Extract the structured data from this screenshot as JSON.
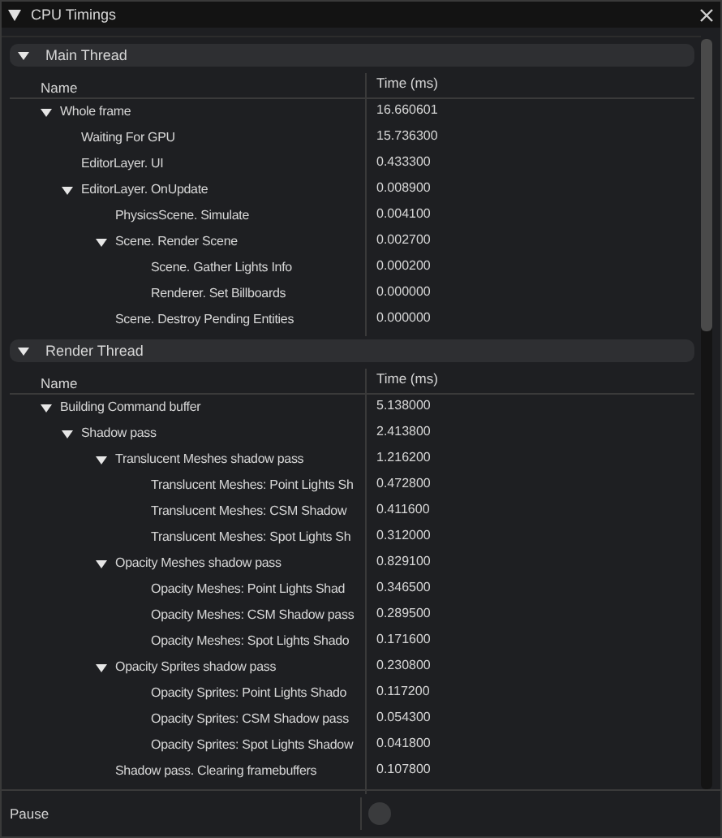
{
  "window": {
    "title": "CPU Timings"
  },
  "sections": [
    {
      "title": "Main Thread",
      "expanded": true,
      "columns": [
        "Name",
        "Time (ms)"
      ],
      "rows": [
        {
          "name": "Whole frame",
          "time": "16.660601",
          "expanded": true,
          "children": [
            {
              "name": "Waiting For GPU",
              "time": "15.736300"
            },
            {
              "name": "EditorLayer. UI",
              "time": "0.433300"
            },
            {
              "name": "EditorLayer. OnUpdate",
              "time": "0.008900",
              "expanded": true,
              "children": [
                {
                  "name": "PhysicsScene. Simulate",
                  "time": "0.004100"
                },
                {
                  "name": "Scene. Render Scene",
                  "time": "0.002700",
                  "expanded": true,
                  "children": [
                    {
                      "name": "Scene. Gather Lights Info",
                      "time": "0.000200"
                    },
                    {
                      "name": "Renderer. Set Billboards",
                      "time": "0.000000"
                    }
                  ]
                },
                {
                  "name": "Scene. Destroy Pending Entities",
                  "time": "0.000000"
                }
              ]
            }
          ]
        }
      ]
    },
    {
      "title": "Render Thread",
      "expanded": true,
      "columns": [
        "Name",
        "Time (ms)"
      ],
      "rows": [
        {
          "name": "Building Command buffer",
          "time": "5.138000",
          "expanded": true,
          "children": [
            {
              "name": "Shadow pass",
              "time": "2.413800",
              "expanded": true,
              "children": [
                {
                  "name": "Translucent Meshes shadow pass",
                  "time": "1.216200",
                  "expanded": true,
                  "children": [
                    {
                      "name": "Translucent Meshes: Point Lights Sh",
                      "time": "0.472800"
                    },
                    {
                      "name": "Translucent Meshes: CSM Shadow",
                      "time": "0.411600"
                    },
                    {
                      "name": "Translucent Meshes: Spot Lights Sh",
                      "time": "0.312000"
                    }
                  ]
                },
                {
                  "name": "Opacity Meshes shadow pass",
                  "time": "0.829100",
                  "expanded": true,
                  "children": [
                    {
                      "name": "Opacity Meshes: Point Lights Shad",
                      "time": "0.346500"
                    },
                    {
                      "name": "Opacity Meshes: CSM Shadow pass",
                      "time": "0.289500"
                    },
                    {
                      "name": "Opacity Meshes: Spot Lights Shado",
                      "time": "0.171600"
                    }
                  ]
                },
                {
                  "name": "Opacity Sprites shadow pass",
                  "time": "0.230800",
                  "expanded": true,
                  "children": [
                    {
                      "name": "Opacity Sprites: Point Lights Shado",
                      "time": "0.117200"
                    },
                    {
                      "name": "Opacity Sprites: CSM Shadow pass",
                      "time": "0.054300"
                    },
                    {
                      "name": "Opacity Sprites: Spot Lights Shadow",
                      "time": "0.041800"
                    }
                  ]
                },
                {
                  "name": "Shadow pass. Clearing framebuffers",
                  "time": "0.107800"
                }
              ]
            }
          ]
        }
      ]
    }
  ],
  "footer": {
    "label": "Pause",
    "checked": false
  }
}
